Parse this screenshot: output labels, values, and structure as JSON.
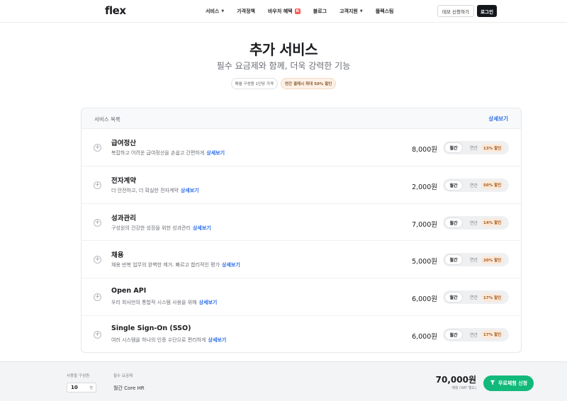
{
  "header": {
    "logo": "flex",
    "nav": [
      {
        "label": "서비스",
        "caret": true
      },
      {
        "label": "가격정책"
      },
      {
        "label": "바우처 혜택",
        "badge": "N"
      },
      {
        "label": "블로그"
      },
      {
        "label": "고객지원",
        "caret": true
      },
      {
        "label": "플렉스팀"
      }
    ],
    "demo_label": "데모 신청하기",
    "login_label": "로그인"
  },
  "hero": {
    "title": "추가 서비스",
    "subtitle": "필수 요금제와 함께, 더욱 강력한 기능",
    "chip_basis": "매월 구성원 1인당 가격",
    "chip_discount": "연간 결제시 최대 50% 할인"
  },
  "panel": {
    "header_label": "서비스 목록",
    "header_link": "상세보기",
    "services": [
      {
        "name": "급여정산",
        "desc": "복잡하고 어려운 급여정산을 손쉽고 간편하게",
        "link": "상세보기",
        "price": "8,000원",
        "monthly": "월간",
        "yearly": "연간",
        "discount": "13% 할인"
      },
      {
        "name": "전자계약",
        "desc": "더 안전하고, 더 확실한 전자계약",
        "link": "상세보기",
        "price": "2,000원",
        "monthly": "월간",
        "yearly": "연간",
        "discount": "50% 할인"
      },
      {
        "name": "성과관리",
        "desc": "구성원의 건강한 성장을 위한 성과관리",
        "link": "상세보기",
        "price": "7,000원",
        "monthly": "월간",
        "yearly": "연간",
        "discount": "14% 할인"
      },
      {
        "name": "채용",
        "desc": "채용 반복 업무의 완벽한 제거. 빠르고 합리적인 평가",
        "link": "상세보기",
        "price": "5,000원",
        "monthly": "월간",
        "yearly": "연간",
        "discount": "20% 할인"
      },
      {
        "name": "Open API",
        "desc": "우리 회사만의 통합적 시스템 사용을 위해",
        "link": "상세보기",
        "price": "6,000원",
        "monthly": "월간",
        "yearly": "연간",
        "discount": "17% 할인"
      },
      {
        "name": "Single Sign-On (SSO)",
        "desc": "여러 시스템을 하나의 인증 수단으로 편리하게",
        "link": "상세보기",
        "price": "6,000원",
        "monthly": "월간",
        "yearly": "연간",
        "discount": "17% 할인"
      }
    ]
  },
  "footer": {
    "members_label": "사용할 구성원",
    "members_value": "10",
    "members_unit": "명",
    "plan_label": "필수 요금제",
    "plan_value": "월간 Core HR",
    "total": "70,000원",
    "total_note": "매월 (VAT 별도)",
    "cta_label": "무료체험 신청"
  },
  "colors": {
    "accent": "#2b6de8",
    "cta": "#11b97a",
    "dark": "#14171c"
  }
}
